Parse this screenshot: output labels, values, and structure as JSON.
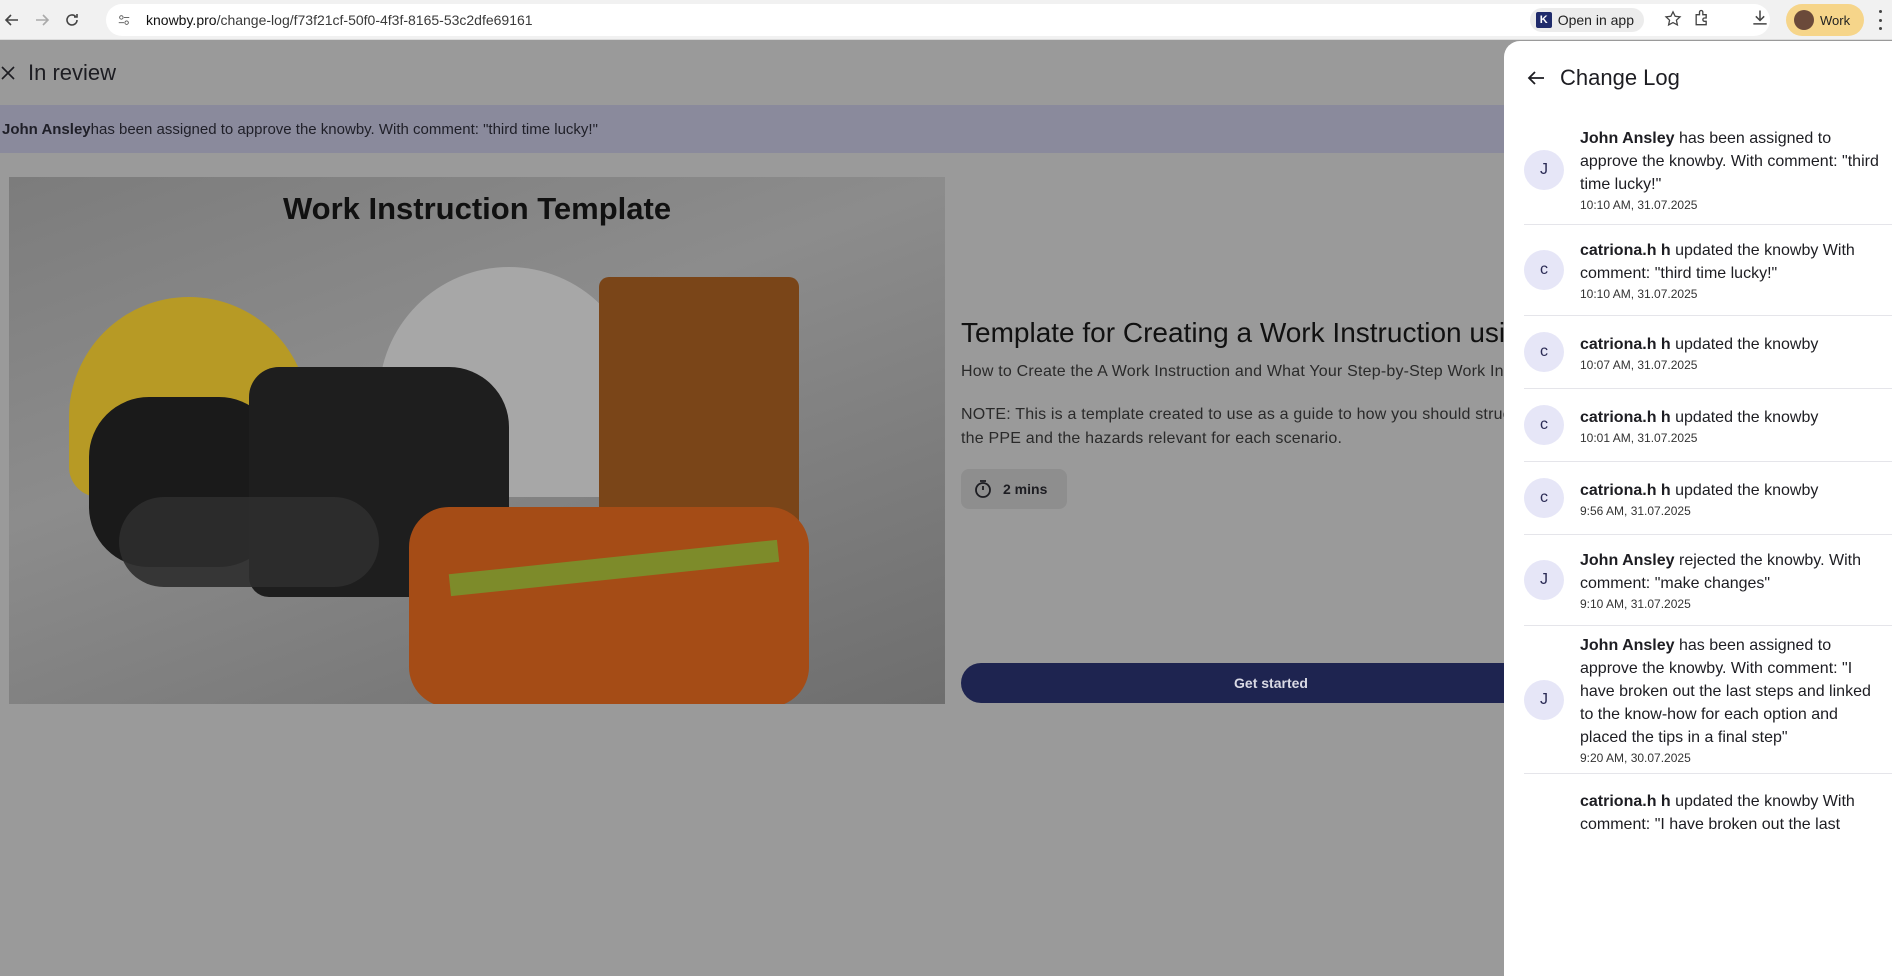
{
  "browser": {
    "url_host": "knowby.pro",
    "url_path": "/change-log/f73f21cf-50f0-4f3f-8165-53c2dfe69161",
    "open_in_app": "Open in app",
    "profile_label": "Work"
  },
  "header": {
    "status": "In review"
  },
  "banner": {
    "name": "John Ansley",
    "text": " has been assigned to approve the knowby. With comment: \"third time lucky!\""
  },
  "hero": {
    "image_title": "Work Instruction Template"
  },
  "content": {
    "title": "Template for Creating a Work Instruction using a Knowby",
    "subtitle": "How to Create the A Work Instruction and What Your Step-by-Step Work Instruction Should Include",
    "note_line1": "NOTE: This is a template created to use as a guide to how you should structure your work instruction, covering",
    "note_line2": "the PPE and the hazards relevant for each scenario.",
    "duration": "2 mins",
    "cta": "Get started"
  },
  "panel": {
    "title": "Change Log",
    "items": [
      {
        "initial": "J",
        "name": "John Ansley",
        "text": " has been assigned to approve the knowby. With comment: \"third time lucky!\"",
        "time": "10:10 AM, 31.07.2025"
      },
      {
        "initial": "c",
        "name": "catriona.h h",
        "text": " updated the knowby With comment: \"third time lucky!\"",
        "time": "10:10 AM, 31.07.2025"
      },
      {
        "initial": "c",
        "name": "catriona.h h",
        "text": " updated the knowby",
        "time": "10:07 AM, 31.07.2025"
      },
      {
        "initial": "c",
        "name": "catriona.h h",
        "text": " updated the knowby",
        "time": "10:01 AM, 31.07.2025"
      },
      {
        "initial": "c",
        "name": "catriona.h h",
        "text": " updated the knowby",
        "time": "9:56 AM, 31.07.2025"
      },
      {
        "initial": "J",
        "name": "John Ansley",
        "text": " rejected the knowby. With comment: \"make changes\"",
        "time": "9:10 AM, 31.07.2025"
      },
      {
        "initial": "J",
        "name": "John Ansley",
        "text": " has been assigned to approve the knowby. With comment: \"I have broken out the last steps and linked to the know-how for each option and placed the tips in a final step\"",
        "time": "9:20 AM, 30.07.2025"
      },
      {
        "initial": "c",
        "name": "catriona.h h",
        "text": " updated the knowby With comment: \"I have broken out the last",
        "time": ""
      }
    ]
  }
}
